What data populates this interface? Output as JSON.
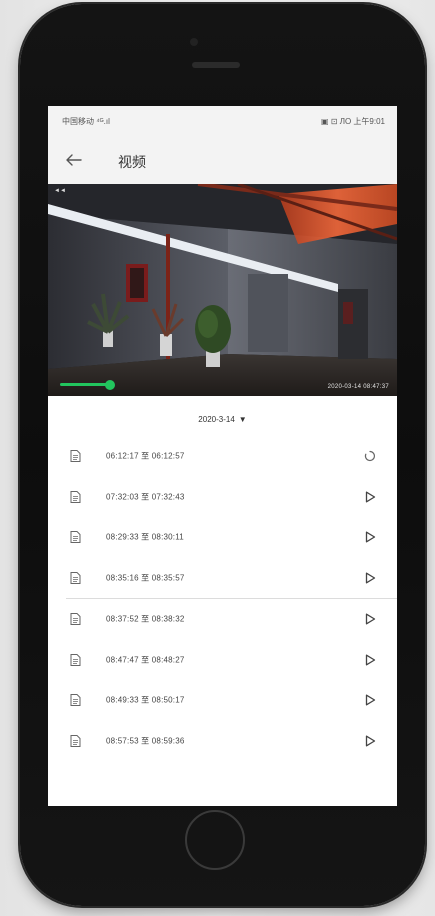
{
  "status_bar": {
    "carrier": "中国移动 ⁴ᴳ.ıl",
    "right": "▣ ⊡ ЛO 上午9:01"
  },
  "header": {
    "title": "视频",
    "back_icon": "arrow-left-icon"
  },
  "video": {
    "camera_label": "◄◄",
    "timestamp": "2020-03-14 08:47:37",
    "progress": 0.24,
    "colors": {
      "progress": "#22c55e"
    }
  },
  "date_selector": {
    "label": "2020-3-14",
    "caret": "▼"
  },
  "recordings": [
    {
      "range": "06:12:17 至 06:12:57",
      "status": "loading"
    },
    {
      "range": "07:32:03 至 07:32:43",
      "status": "play"
    },
    {
      "range": "08:29:33 至 08:30:11",
      "status": "play"
    },
    {
      "range": "08:35:16 至 08:35:57",
      "status": "play"
    },
    {
      "range": "08:37:52 至 08:38:32",
      "status": "play"
    },
    {
      "range": "08:47:47 至 08:48:27",
      "status": "play"
    },
    {
      "range": "08:49:33 至 08:50:17",
      "status": "play"
    },
    {
      "range": "08:57:53 至 08:59:36",
      "status": "play"
    }
  ]
}
